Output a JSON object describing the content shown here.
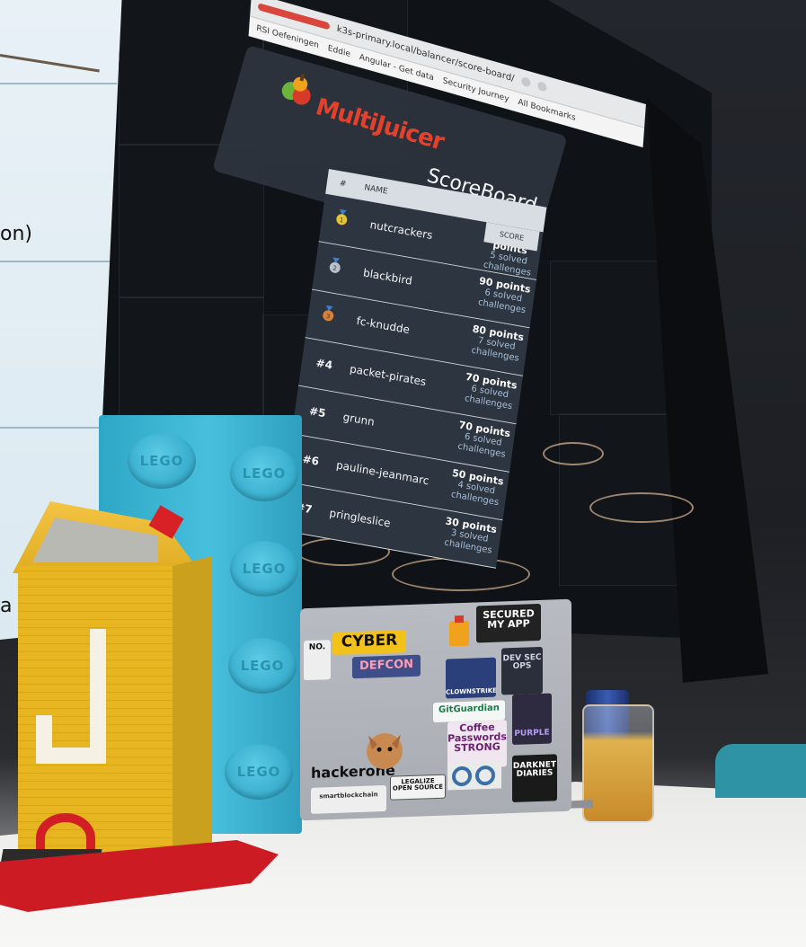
{
  "browser": {
    "url": "k3s-primary.local/balancer/score-board/",
    "bookmarks": [
      "RSI Oefeningen",
      "Eddie",
      "Angular - Get data",
      "Security Journey",
      "All Bookmarks"
    ]
  },
  "app": {
    "brand": "MultiJuicer",
    "title": "ScoreBoard"
  },
  "scoreboard": {
    "columns": {
      "rank": "#",
      "name": "NAME",
      "score": "SCORE"
    },
    "rows": [
      {
        "rank": "1",
        "medal": "gold",
        "name": "nutcrackers",
        "points": "100 points",
        "solved": "5 solved challenges"
      },
      {
        "rank": "2",
        "medal": "silver",
        "name": "blackbird",
        "points": "90 points",
        "solved": "6 solved challenges"
      },
      {
        "rank": "3",
        "medal": "bronze",
        "name": "fc-knudde",
        "points": "80 points",
        "solved": "7 solved challenges"
      },
      {
        "rank": "#4",
        "name": "packet-pirates",
        "points": "70 points",
        "solved": "6 solved challenges"
      },
      {
        "rank": "#5",
        "name": "grunn",
        "points": "70 points",
        "solved": "6 solved challenges"
      },
      {
        "rank": "#6",
        "name": "pauline-jeanmarc",
        "points": "50 points",
        "solved": "4 solved challenges"
      },
      {
        "rank": "#7",
        "name": "pringleslice",
        "points": "30 points",
        "solved": "3 solved challenges"
      }
    ]
  },
  "projection": {
    "text": "on)",
    "text2": "a"
  },
  "lego": {
    "stud_label": "LEGO"
  },
  "stickers": {
    "cyber": "CYBER",
    "defcon": "DEFCON",
    "secured": "SECURED MY APP",
    "devsecops": "DEV SEC OPS",
    "clownstrike": "CLOWNSTRIKE",
    "gitguardian": "GitGuardian",
    "coffee": "Coffee",
    "passwords": "Passwords",
    "strong": "STRONG",
    "purple": "PURPLE",
    "hackerone": "hackerone",
    "legalize": "LEGALIZE OPEN SOURCE",
    "darknet": "DARKNET DIARIES",
    "smartblockchain": "smartblockchain",
    "no": "NO."
  },
  "colors": {
    "brand_red": "#e4402b",
    "row_bg": "#2c3540",
    "header_bg": "#d7dde3",
    "score_link": "#a9bfd8",
    "lego_blue": "#47bfdd",
    "lego_yellow": "#e6b51f"
  }
}
